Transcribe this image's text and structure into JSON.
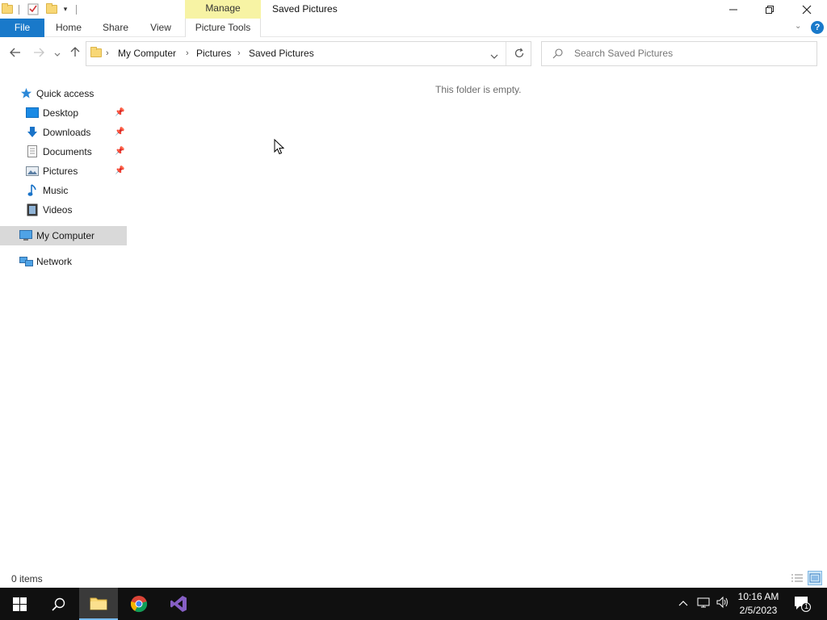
{
  "window": {
    "title": "Saved Pictures",
    "manage_tab": "Manage",
    "buttons": {
      "minimize": "—",
      "restore": "❐",
      "close": "✕"
    }
  },
  "ribbon": {
    "tabs": [
      "File",
      "Home",
      "Share",
      "View",
      "Picture Tools"
    ],
    "help": "?"
  },
  "address": {
    "breadcrumbs": [
      "My Computer",
      "Pictures",
      "Saved Pictures"
    ],
    "search_placeholder": "Search Saved Pictures"
  },
  "navpane": {
    "quick_access": "Quick access",
    "items": [
      {
        "label": "Desktop",
        "icon": "desktop-icon",
        "pinned": true
      },
      {
        "label": "Downloads",
        "icon": "downloads-icon",
        "pinned": true
      },
      {
        "label": "Documents",
        "icon": "documents-icon",
        "pinned": true
      },
      {
        "label": "Pictures",
        "icon": "pictures-icon",
        "pinned": true
      },
      {
        "label": "Music",
        "icon": "music-icon",
        "pinned": false
      },
      {
        "label": "Videos",
        "icon": "videos-icon",
        "pinned": false
      }
    ],
    "my_computer": "My Computer",
    "network": "Network"
  },
  "content": {
    "empty_message": "This folder is empty."
  },
  "status": {
    "item_count": "0 items"
  },
  "taskbar": {
    "time": "10:16 AM",
    "date": "2/5/2023",
    "notification_count": "1"
  },
  "colors": {
    "accent": "#1979ca",
    "manage_tab": "#f7f3a4",
    "selected": "#d9d9d9",
    "taskbar": "#101010"
  }
}
